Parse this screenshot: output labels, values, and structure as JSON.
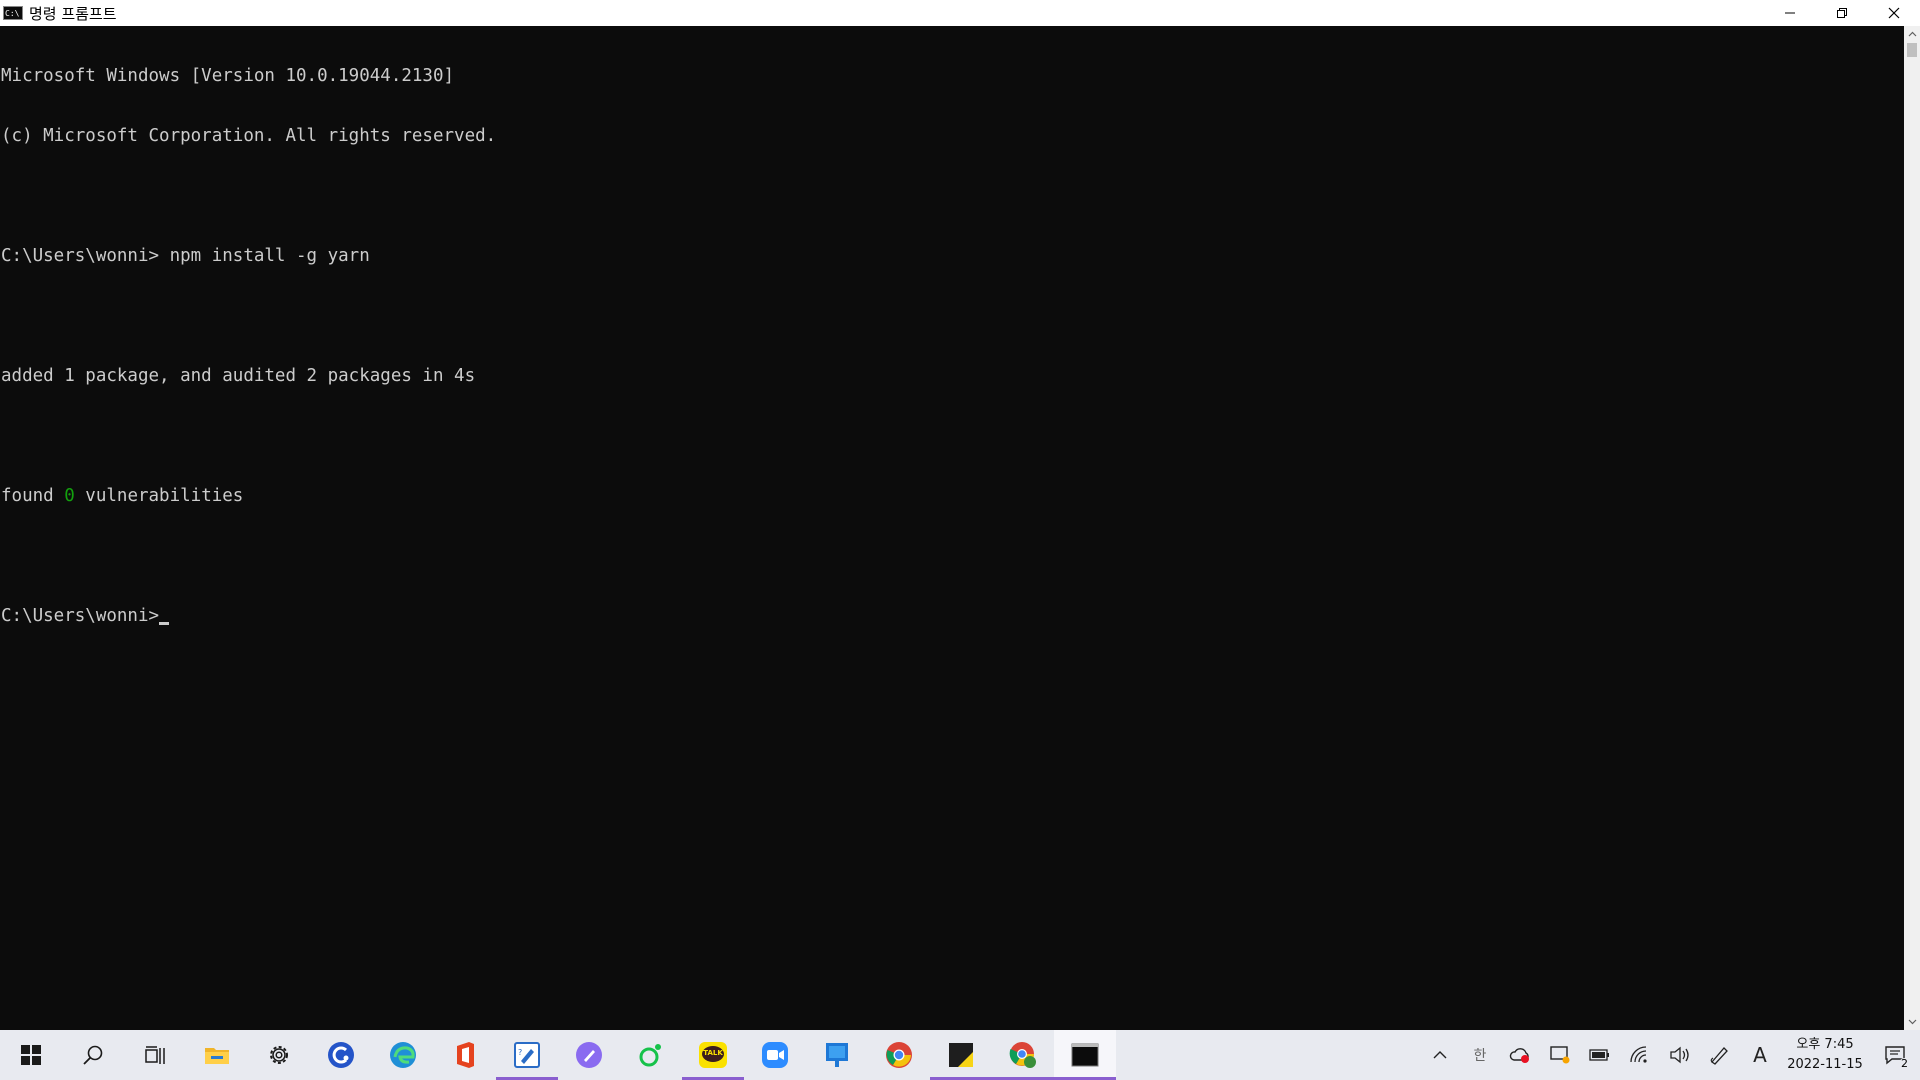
{
  "window": {
    "title": "명령 프롬프트",
    "app_icon_text": "C:\\",
    "controls": {
      "minimize_icon": "minimize-icon",
      "maximize_icon": "restore-icon",
      "close_icon": "close-icon"
    }
  },
  "console": {
    "lines": [
      "Microsoft Windows [Version 10.0.19044.2130]",
      "(c) Microsoft Corporation. All rights reserved.",
      "",
      "C:\\Users\\wonni> npm install -g yarn",
      "",
      "added 1 package, and audited 2 packages in 4s",
      "",
      "found ",
      "",
      "C:\\Users\\wonni>"
    ],
    "found_prefix": "found ",
    "found_count": "0",
    "found_suffix": " vulnerabilities",
    "prompt": "C:\\Users\\wonni>",
    "colors": {
      "background": "#0c0c0c",
      "text": "#cccccc",
      "highlight": "#13a10e"
    }
  },
  "taskbar": {
    "items": [
      {
        "name": "start-button",
        "icon": "windows-logo-icon"
      },
      {
        "name": "search-button",
        "icon": "search-icon"
      },
      {
        "name": "task-view-button",
        "icon": "task-view-icon"
      },
      {
        "name": "file-explorer",
        "icon": "folder-icon"
      },
      {
        "name": "settings",
        "icon": "gear-icon"
      },
      {
        "name": "app-blue-c",
        "icon": "blue-c-icon"
      },
      {
        "name": "edge",
        "icon": "edge-icon"
      },
      {
        "name": "office",
        "icon": "office-icon"
      },
      {
        "name": "app-pen",
        "icon": "pen-note-icon"
      },
      {
        "name": "app-purple-pen",
        "icon": "purple-pen-icon"
      },
      {
        "name": "app-green",
        "icon": "green-circle-icon"
      },
      {
        "name": "kakaotalk",
        "icon": "kakaotalk-icon"
      },
      {
        "name": "zoom",
        "icon": "zoom-icon"
      },
      {
        "name": "app-blue-board",
        "icon": "blue-board-icon"
      },
      {
        "name": "chrome",
        "icon": "chrome-icon"
      },
      {
        "name": "sticky-notes",
        "icon": "sticky-notes-icon"
      },
      {
        "name": "chrome-profile",
        "icon": "chrome-profile-icon"
      },
      {
        "name": "command-prompt",
        "icon": "cmd-icon"
      }
    ],
    "kakao_label": "TALK",
    "tray": {
      "clock_ampm_time": "오후 7:45",
      "clock_date": "2022-11-15",
      "ime_label": "A",
      "hangul_label": "한",
      "notification_count": "2"
    }
  }
}
